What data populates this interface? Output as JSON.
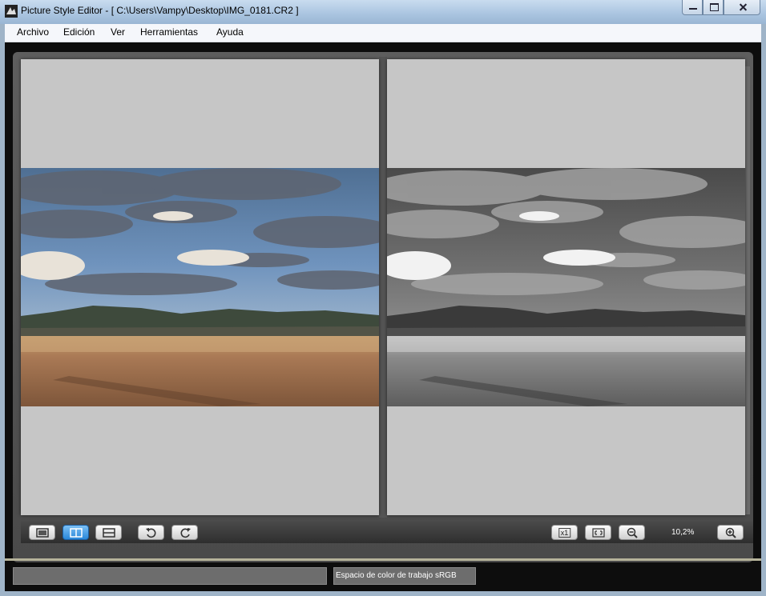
{
  "window": {
    "title": "Picture Style Editor - [ C:\\Users\\Vampy\\Desktop\\IMG_0181.CR2 ]"
  },
  "menu": {
    "items": [
      "Archivo",
      "Edición",
      "Ver",
      "Herramientas",
      "Ayuda"
    ]
  },
  "toolbar": {
    "view_buttons": [
      "single-view-icon",
      "side-by-side-view-icon",
      "top-bottom-view-icon"
    ],
    "active_view": "side-by-side",
    "rotate_buttons": [
      "rotate-left-icon",
      "rotate-right-icon"
    ],
    "actual_size_label": "x1",
    "zoom_level": "10,2%"
  },
  "status": {
    "color_space": "Espacio de color de trabajo sRGB"
  },
  "colors": {
    "accent": "#2a87d9",
    "workspace": "#4a4a4a",
    "panel": "#c6c6c6"
  }
}
